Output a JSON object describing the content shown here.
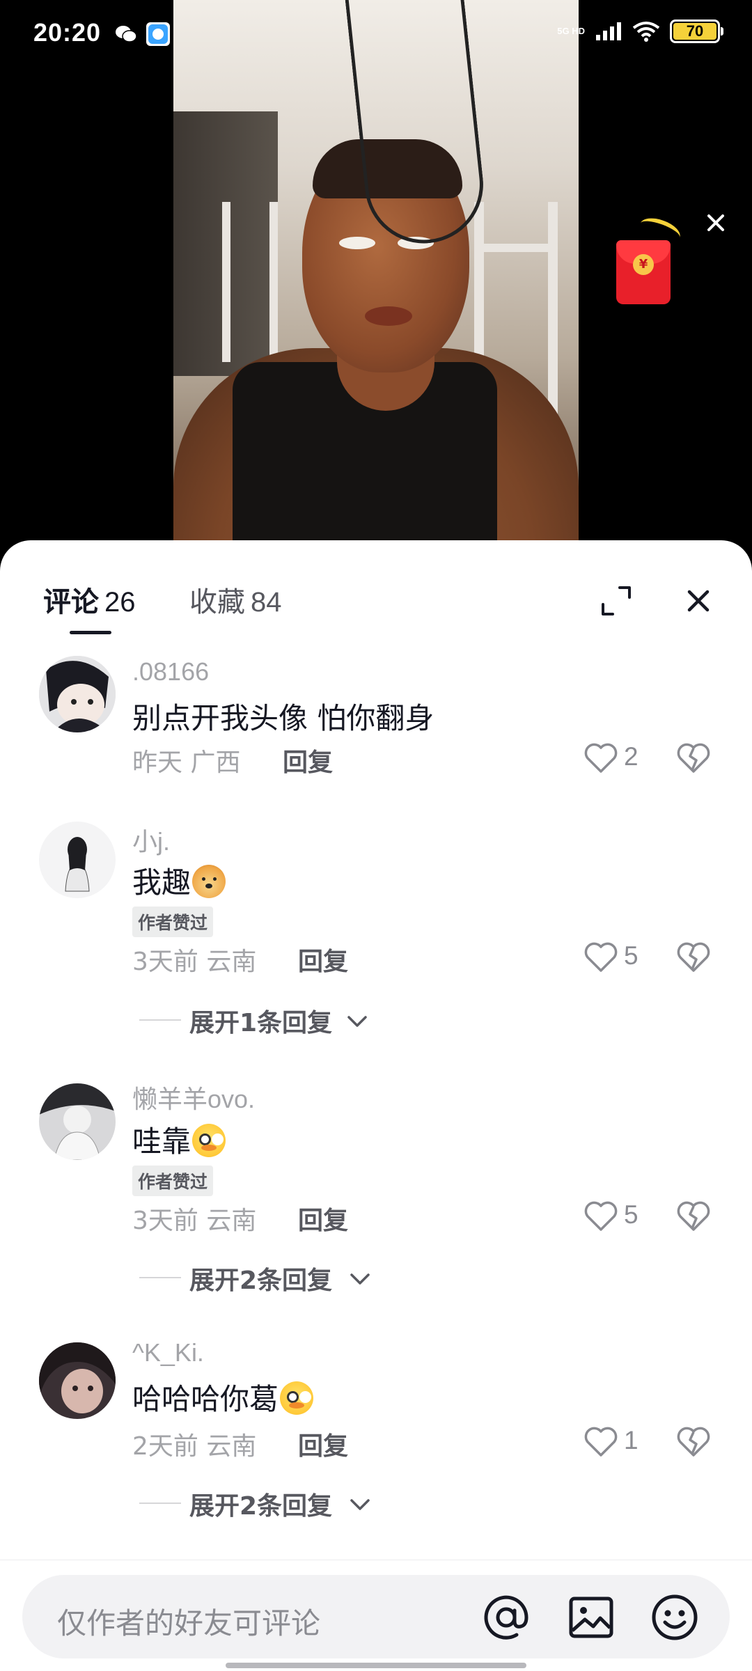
{
  "status_bar": {
    "time": "20:20",
    "network_top": "5G HD",
    "battery_level": "70"
  },
  "video": {
    "red_packet_symbol": "¥",
    "red_packet_close_icon": "close-icon"
  },
  "sheet": {
    "tabs": [
      {
        "label": "评论",
        "count": "26"
      },
      {
        "label": "收藏",
        "count": "84"
      }
    ],
    "expand_icon": "fullscreen-icon",
    "close_icon": "close-icon"
  },
  "comments": [
    {
      "user": ".08166",
      "text": "别点开我头像 怕你翻身",
      "emoji": "",
      "badge": "",
      "meta": "昨天 广西",
      "reply_label": "回复",
      "likes": "2",
      "expand": ""
    },
    {
      "user": "小j.",
      "text": "我趣",
      "emoji": "doge",
      "badge": "作者赞过",
      "meta": "3天前 云南",
      "reply_label": "回复",
      "likes": "5",
      "expand": "展开1条回复"
    },
    {
      "user": "懒羊羊ovo.",
      "text": "哇靠",
      "emoji": "flushed",
      "badge": "作者赞过",
      "meta": "3天前 云南",
      "reply_label": "回复",
      "likes": "5",
      "expand": "展开2条回复"
    },
    {
      "user": "^K_Ki.",
      "text": "哈哈哈你葛",
      "emoji": "flushed",
      "badge": "",
      "meta": "2天前 云南",
      "reply_label": "回复",
      "likes": "1",
      "expand": "展开2条回复"
    }
  ],
  "input_bar": {
    "placeholder": "仅作者的好友可评论",
    "icons": [
      "at-icon",
      "image-icon",
      "emoji-icon"
    ]
  },
  "colors": {
    "battery": "#f5d13a",
    "red_packet": "#e8202a",
    "text_primary": "#161823",
    "text_secondary": "#a3a4a8"
  }
}
